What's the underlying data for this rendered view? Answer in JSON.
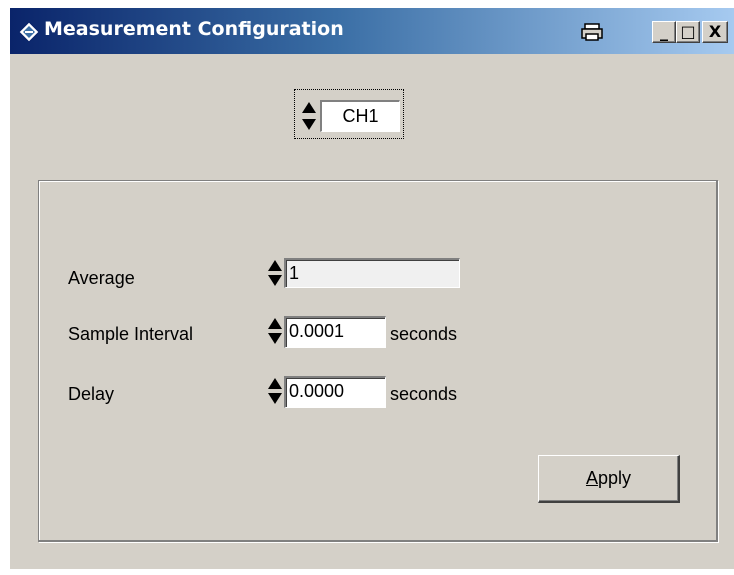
{
  "window": {
    "title": "Measurement Configuration",
    "buttons": {
      "minimize": "_",
      "maximize": "□",
      "close": "X"
    }
  },
  "channel": {
    "value": "CH1"
  },
  "form": {
    "average": {
      "label": "Average",
      "value": "1"
    },
    "sample_interval": {
      "label": "Sample Interval",
      "value": "0.0001",
      "unit": "seconds"
    },
    "delay": {
      "label": "Delay",
      "value": "0.0000",
      "unit": "seconds"
    }
  },
  "apply_button": {
    "mnemonic": "A",
    "rest": "pply"
  },
  "icons": {
    "app": "rohde-schwarz-logo-icon",
    "print": "print-icon",
    "spinner": "spinner-arrows-icon"
  },
  "colors": {
    "face": "#d4d0c8",
    "title_start": "#0a246a",
    "title_end": "#a6caf0"
  }
}
